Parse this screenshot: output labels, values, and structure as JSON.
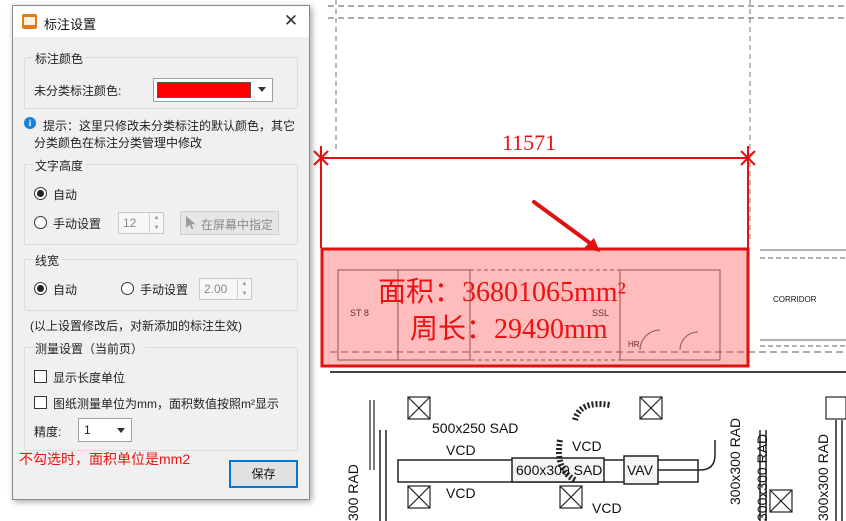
{
  "dialog": {
    "title": "标注设置",
    "close_glyph": "✕",
    "color_group": {
      "title": "标注颜色",
      "label": "未分类标注颜色:",
      "color": "#ff0000"
    },
    "hint_icon": "info-icon",
    "hint_text_line1": "提示：这里只修改未分类标注的默认颜色，其它",
    "hint_text_line2": "分类颜色在标注分类管理中修改",
    "text_height_group": {
      "title": "文字高度",
      "auto_label": "自动",
      "auto_selected": true,
      "manual_label": "手动设置",
      "manual_value": "12",
      "pick_button": "在屏幕中指定"
    },
    "line_width_group": {
      "title": "线宽",
      "auto_label": "自动",
      "auto_selected": true,
      "manual_label": "手动设置",
      "manual_value": "2.00"
    },
    "effect_note": "(以上设置修改后，对新添加的标注生效)",
    "measure_group": {
      "title": "测量设置（当前页）",
      "show_unit_label": "显示长度单位",
      "show_unit_checked": false,
      "mm_label": "图纸测量单位为mm，面积数值按照m²显示",
      "mm_checked": false,
      "precision_label": "精度:",
      "precision_value": "1"
    },
    "save_button": "保存"
  },
  "annotation_note": "不勾选时，面积单位是mm2",
  "measurement": {
    "width_label": "11571",
    "area_text": "面积：36801065mm²",
    "perimeter_text": "周长：29490mm"
  },
  "drawing_labels": {
    "room1": "ST 8",
    "room2": "SSL",
    "room3": "HR",
    "corridor": "CORRIDOR",
    "duct1": "500x250 SAD",
    "vcd1": "VCD",
    "vcd2": "VCD",
    "vcd3": "VCD",
    "vcd4": "VCD",
    "duct2": "600x300 SAD",
    "vav": "VAV",
    "rad1": "300 RAD",
    "rad2": "300x300 RAD",
    "rad3": "300x300 RAD",
    "rad4": "300x300 RAD"
  },
  "colors": {
    "annotation_red": "#e11111",
    "accent_blue": "#0078d7"
  }
}
